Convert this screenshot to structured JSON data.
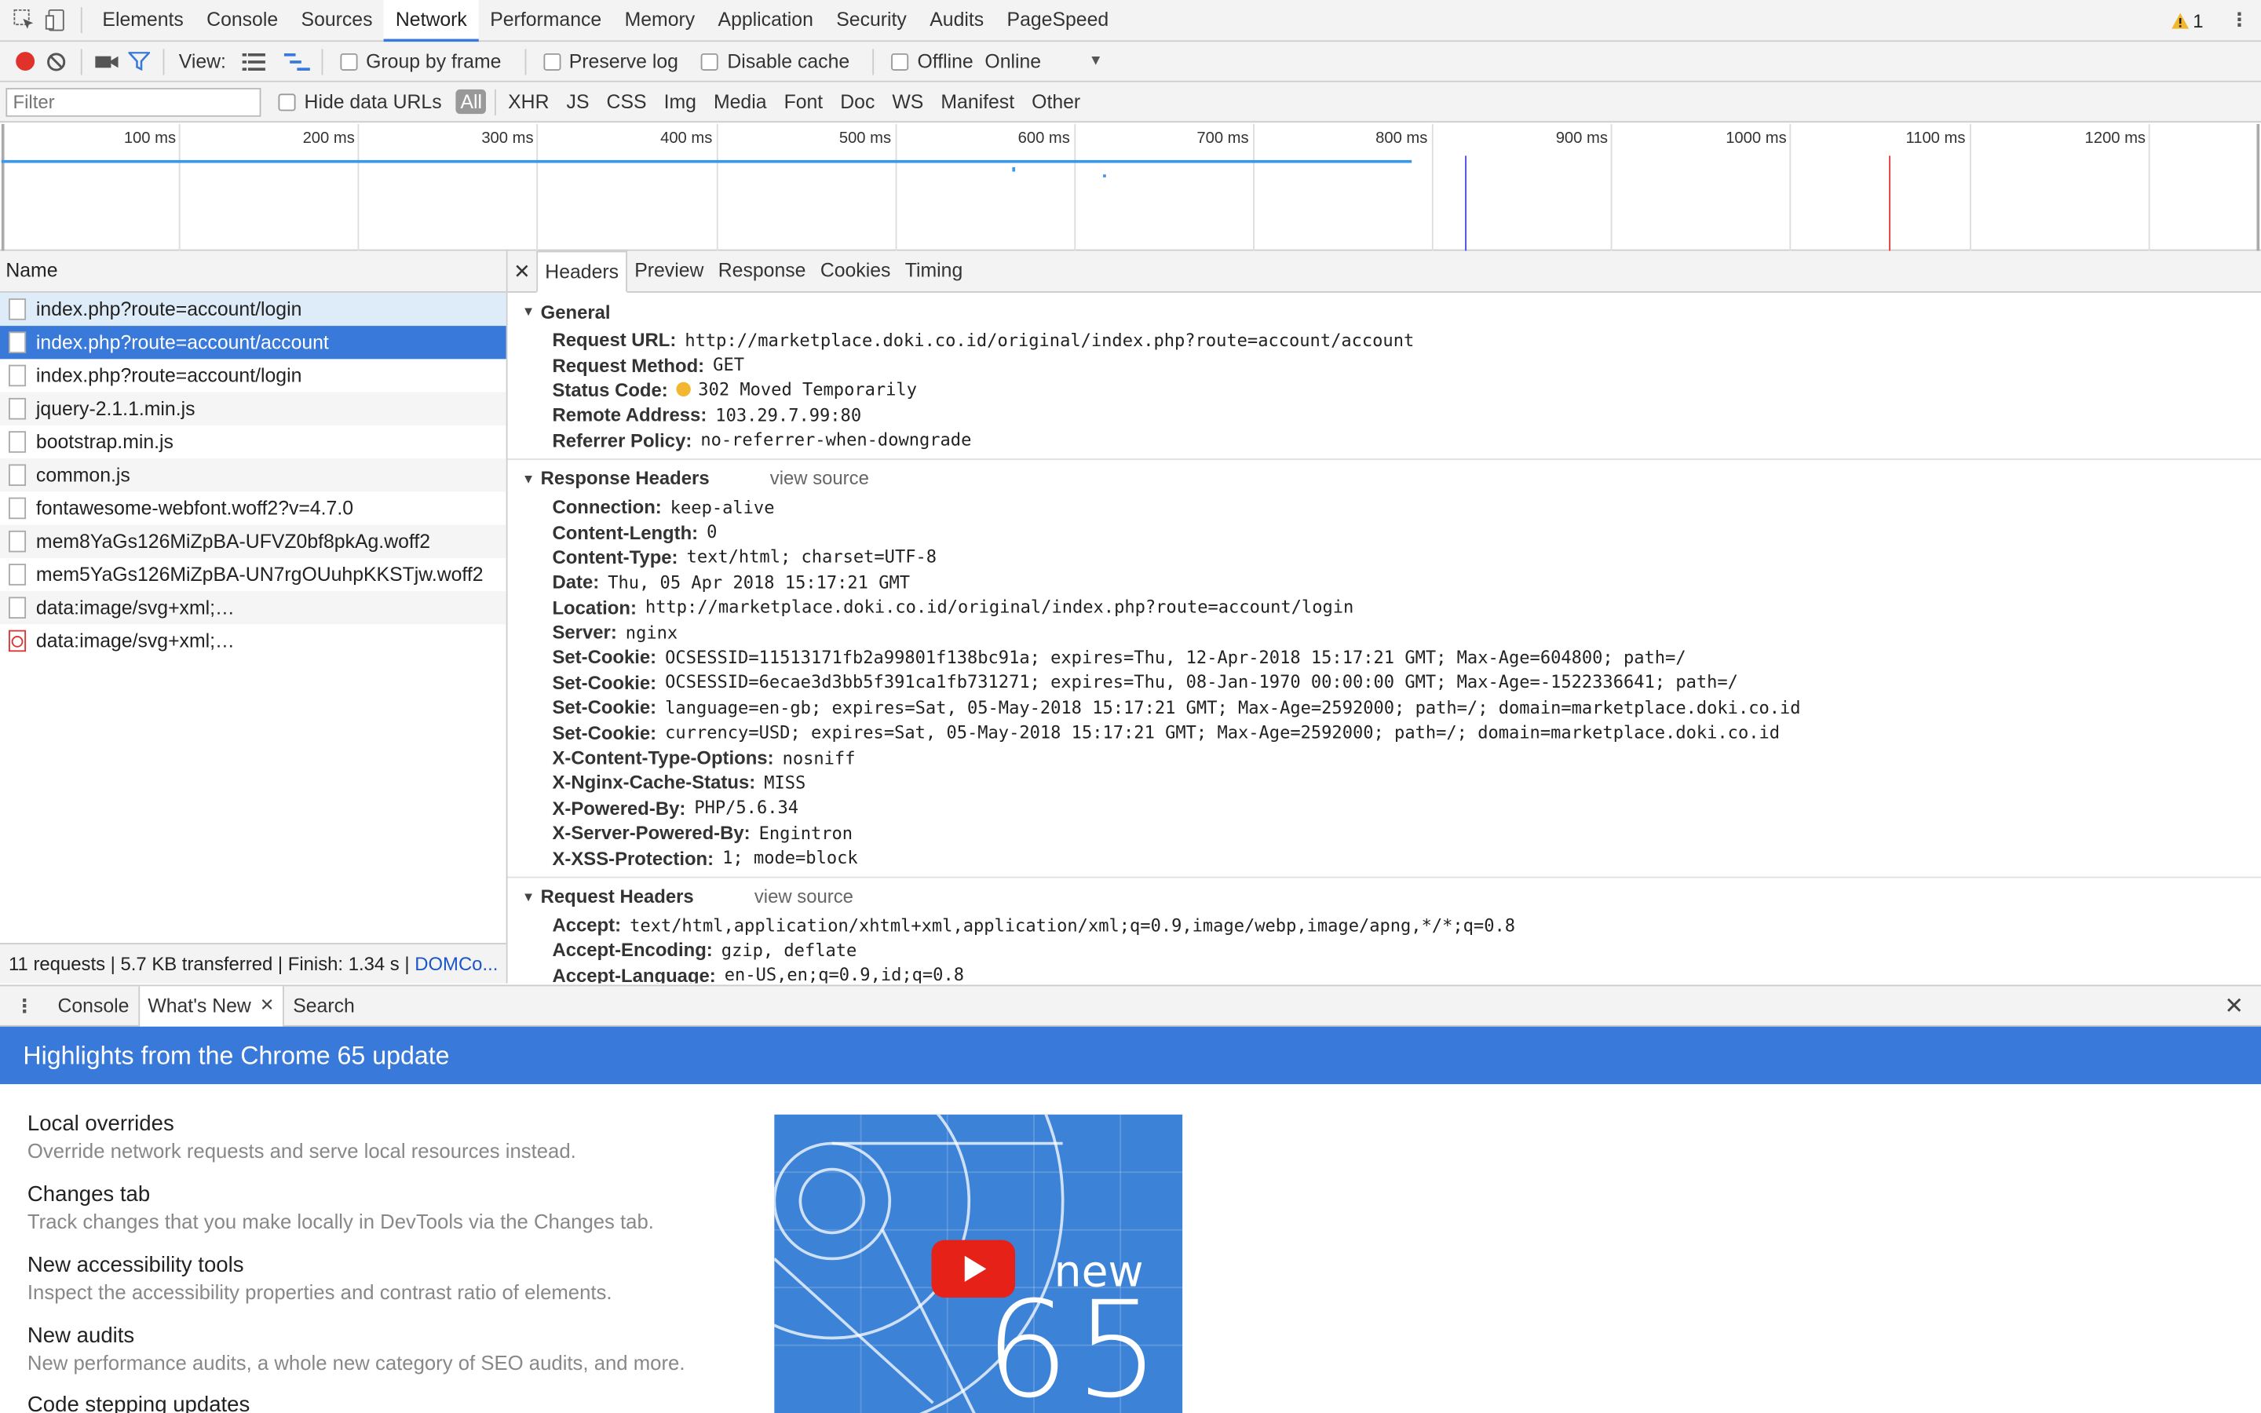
{
  "topbar": {
    "tabs": [
      "Elements",
      "Console",
      "Sources",
      "Network",
      "Performance",
      "Memory",
      "Application",
      "Security",
      "Audits",
      "PageSpeed"
    ],
    "warning_count": "1"
  },
  "toolbar": {
    "view_label": "View:",
    "group_by_frame": "Group by frame",
    "preserve_log": "Preserve log",
    "disable_cache": "Disable cache",
    "offline": "Offline",
    "throttle_value": "Online"
  },
  "filterbar": {
    "placeholder": "Filter",
    "hide_data_urls": "Hide data URLs",
    "types": [
      "All",
      "XHR",
      "JS",
      "CSS",
      "Img",
      "Media",
      "Font",
      "Doc",
      "WS",
      "Manifest",
      "Other"
    ]
  },
  "timeline": {
    "ticks": [
      "100 ms",
      "200 ms",
      "300 ms",
      "400 ms",
      "500 ms",
      "600 ms",
      "700 ms",
      "800 ms",
      "900 ms",
      "1000 ms",
      "1100 ms",
      "1200 ms"
    ]
  },
  "requests": {
    "header": "Name",
    "items": [
      "index.php?route=account/login",
      "index.php?route=account/account",
      "index.php?route=account/login",
      "jquery-2.1.1.min.js",
      "bootstrap.min.js",
      "common.js",
      "fontawesome-webfont.woff2?v=4.7.0",
      "mem8YaGs126MiZpBA-UFVZ0bf8pkAg.woff2",
      "mem5YaGs126MiZpBA-UN7rgOUuhpKKSTjw.woff2",
      "data:image/svg+xml;…",
      "data:image/svg+xml;…"
    ],
    "summary": "11 requests | 5.7 KB transferred | Finish: 1.34 s | ",
    "summary_link": "DOMCo..."
  },
  "detail": {
    "tabs": [
      "Headers",
      "Preview",
      "Response",
      "Cookies",
      "Timing"
    ],
    "general": {
      "title": "General",
      "rows": [
        {
          "k": "Request URL:",
          "v": "http://marketplace.doki.co.id/original/index.php?route=account/account"
        },
        {
          "k": "Request Method:",
          "v": "GET"
        },
        {
          "k": "Status Code:",
          "v": "302 Moved Temporarily"
        },
        {
          "k": "Remote Address:",
          "v": "103.29.7.99:80"
        },
        {
          "k": "Referrer Policy:",
          "v": "no-referrer-when-downgrade"
        }
      ]
    },
    "response_headers": {
      "title": "Response Headers",
      "view_source": "view source",
      "rows": [
        {
          "k": "Connection:",
          "v": "keep-alive"
        },
        {
          "k": "Content-Length:",
          "v": "0"
        },
        {
          "k": "Content-Type:",
          "v": "text/html; charset=UTF-8"
        },
        {
          "k": "Date:",
          "v": "Thu, 05 Apr 2018 15:17:21 GMT"
        },
        {
          "k": "Location:",
          "v": "http://marketplace.doki.co.id/original/index.php?route=account/login"
        },
        {
          "k": "Server:",
          "v": "nginx"
        },
        {
          "k": "Set-Cookie:",
          "v": "OCSESSID=11513171fb2a99801f138bc91a; expires=Thu, 12-Apr-2018 15:17:21 GMT; Max-Age=604800; path=/"
        },
        {
          "k": "Set-Cookie:",
          "v": "OCSESSID=6ecae3d3bb5f391ca1fb731271; expires=Thu, 08-Jan-1970 00:00:00 GMT; Max-Age=-1522336641; path=/"
        },
        {
          "k": "Set-Cookie:",
          "v": "language=en-gb; expires=Sat, 05-May-2018 15:17:21 GMT; Max-Age=2592000; path=/; domain=marketplace.doki.co.id"
        },
        {
          "k": "Set-Cookie:",
          "v": "currency=USD; expires=Sat, 05-May-2018 15:17:21 GMT; Max-Age=2592000; path=/; domain=marketplace.doki.co.id"
        },
        {
          "k": "X-Content-Type-Options:",
          "v": "nosniff"
        },
        {
          "k": "X-Nginx-Cache-Status:",
          "v": "MISS"
        },
        {
          "k": "X-Powered-By:",
          "v": "PHP/5.6.34"
        },
        {
          "k": "X-Server-Powered-By:",
          "v": "Engintron"
        },
        {
          "k": "X-XSS-Protection:",
          "v": "1; mode=block"
        }
      ]
    },
    "request_headers": {
      "title": "Request Headers",
      "view_source": "view source",
      "rows": [
        {
          "k": "Accept:",
          "v": "text/html,application/xhtml+xml,application/xml;q=0.9,image/webp,image/apng,*/*;q=0.8"
        },
        {
          "k": "Accept-Encoding:",
          "v": "gzip, deflate"
        },
        {
          "k": "Accept-Language:",
          "v": "en-US,en;q=0.9,id;q=0.8"
        }
      ]
    }
  },
  "drawer": {
    "tabs": [
      "Console",
      "What's New",
      "Search"
    ],
    "banner": "Highlights from the Chrome 65 update",
    "items": [
      {
        "title": "Local overrides",
        "desc": "Override network requests and serve local resources instead."
      },
      {
        "title": "Changes tab",
        "desc": "Track changes that you make locally in DevTools via the Changes tab."
      },
      {
        "title": "New accessibility tools",
        "desc": "Inspect the accessibility properties and contrast ratio of elements."
      },
      {
        "title": "New audits",
        "desc": "New performance audits, a whole new category of SEO audits, and more."
      },
      {
        "title": "Code stepping updates",
        "desc": ""
      }
    ],
    "video": {
      "word": "new",
      "number": "65"
    }
  },
  "colors": {
    "accent": "#3879d9",
    "record": "#e0312b",
    "warning": "#f2b72e"
  }
}
